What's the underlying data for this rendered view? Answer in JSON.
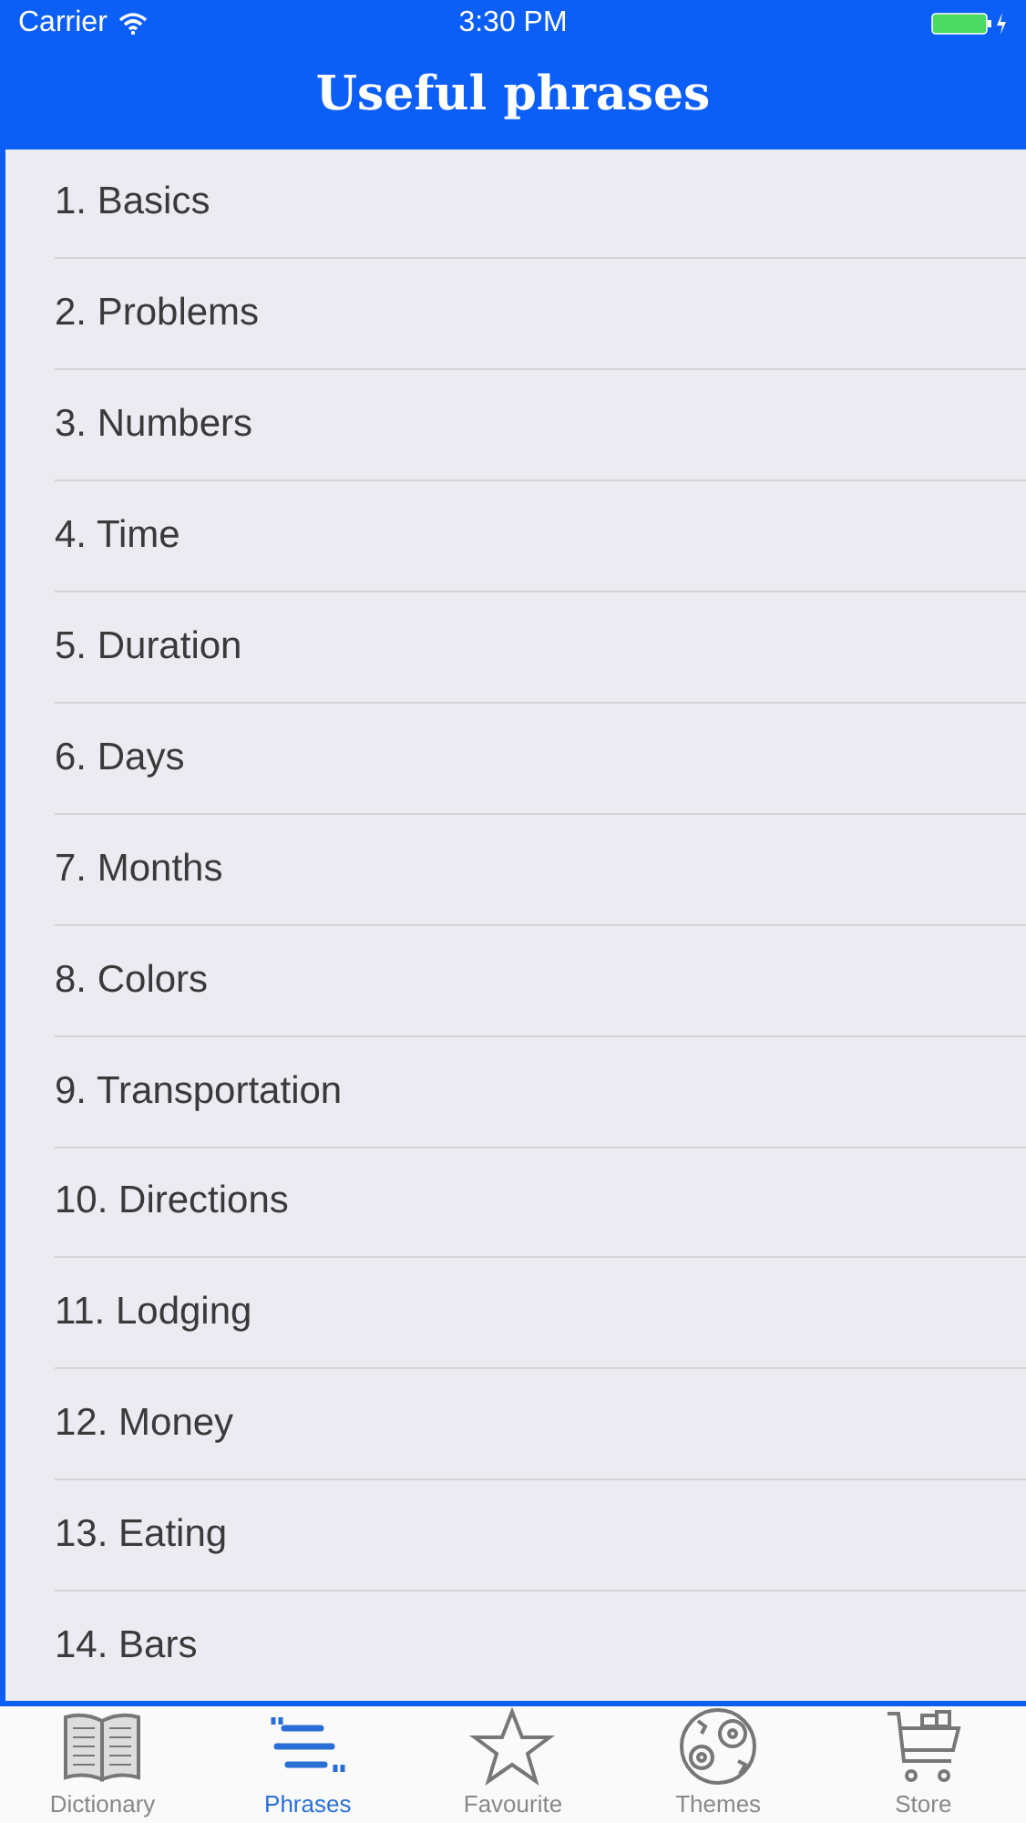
{
  "status_bar": {
    "carrier": "Carrier",
    "time": "3:30 PM",
    "battery_charging": true
  },
  "nav_bar": {
    "title": "Useful phrases"
  },
  "phrases": [
    "1. Basics",
    "2. Problems",
    "3. Numbers",
    "4. Time",
    "5. Duration",
    "6. Days",
    "7. Months",
    "8. Colors",
    "9. Transportation",
    "10. Directions",
    "11. Lodging",
    "12. Money",
    "13. Eating",
    "14. Bars"
  ],
  "tab_bar": [
    {
      "kind": "book",
      "label": "Dictionary",
      "selected": false
    },
    {
      "kind": "quote",
      "label": "Phrases",
      "selected": true
    },
    {
      "kind": "star",
      "label": "Favourite",
      "selected": false
    },
    {
      "kind": "themes",
      "label": "Themes",
      "selected": false
    },
    {
      "kind": "cart",
      "label": "Store",
      "selected": false
    }
  ]
}
